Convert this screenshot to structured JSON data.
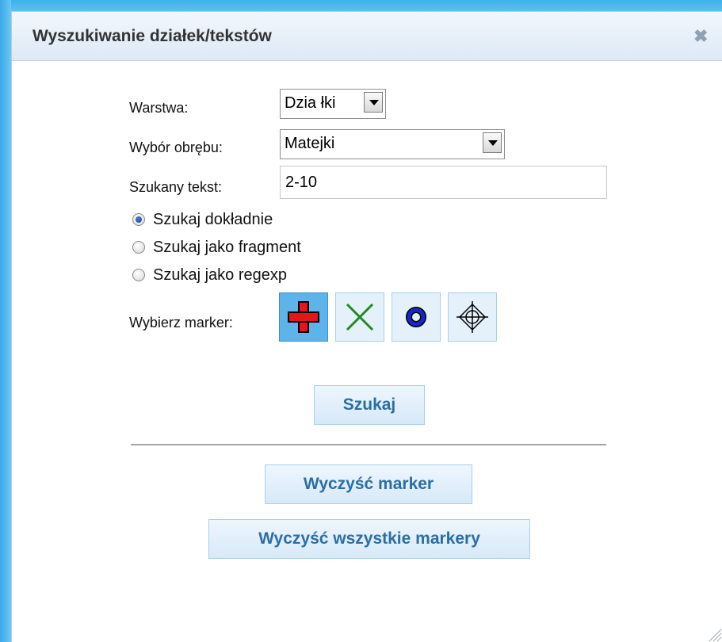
{
  "dialog": {
    "title": "Wyszukiwanie działek/tekstów",
    "close_symbol": "✖"
  },
  "form": {
    "layer": {
      "label": "Warstwa:",
      "value": "Dzia łki"
    },
    "precinct": {
      "label": "Wybór obrębu:",
      "value": "Matejki"
    },
    "search_text": {
      "label": "Szukany tekst:",
      "value": "2-10"
    },
    "search_modes": [
      {
        "label": "Szukaj dokładnie",
        "checked": true
      },
      {
        "label": "Szukaj jako fragment",
        "checked": false
      },
      {
        "label": "Szukaj jako regexp",
        "checked": false
      }
    ],
    "marker": {
      "label": "Wybierz marker:",
      "options": [
        {
          "icon": "red-cross-icon",
          "color": "#e8141b",
          "selected": true
        },
        {
          "icon": "green-x-icon",
          "color": "#1e8a1e",
          "selected": false
        },
        {
          "icon": "blue-ring-icon",
          "color": "#1428c8",
          "selected": false
        },
        {
          "icon": "crosshair-icon",
          "color": "#000000",
          "selected": false
        }
      ]
    }
  },
  "buttons": {
    "search": "Szukaj",
    "clear_marker": "Wyczyść marker",
    "clear_all_markers": "Wyczyść wszystkie markery"
  }
}
